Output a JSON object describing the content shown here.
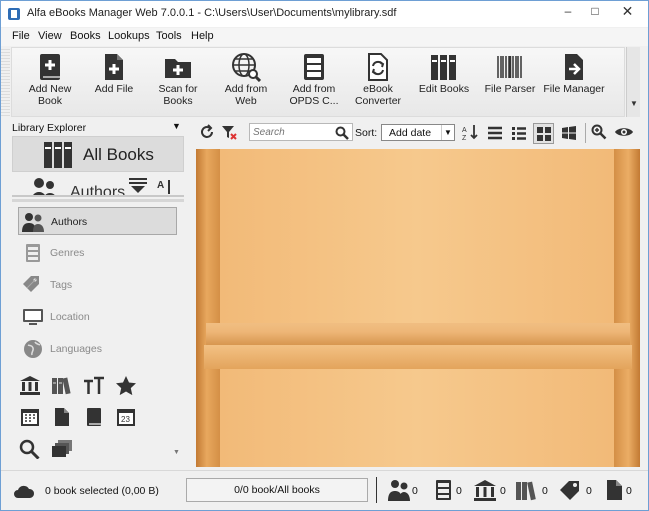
{
  "window": {
    "title": "Alfa eBooks Manager Web 7.0.0.1 - C:\\Users\\User\\Documents\\mylibrary.sdf",
    "minimize": "–",
    "maximize": "□",
    "close": "✕"
  },
  "menu": [
    "File",
    "View",
    "Books",
    "Lookups",
    "Tools",
    "Help"
  ],
  "toolbar": {
    "buttons": [
      {
        "label": "Add New Book",
        "icon": "add-new-book-icon"
      },
      {
        "label": "Add File",
        "icon": "add-file-icon"
      },
      {
        "label": "Scan for Books",
        "icon": "scan-folder-icon"
      },
      {
        "label": "Add from Web",
        "icon": "globe-search-icon"
      },
      {
        "label": "Add from OPDS C...",
        "icon": "opds-cabinet-icon"
      },
      {
        "label": "eBook Converter",
        "icon": "converter-icon"
      },
      {
        "label": "Edit Books",
        "icon": "books-edit-icon"
      },
      {
        "label": "File Parser",
        "icon": "barcode-icon"
      },
      {
        "label": "File Manager",
        "icon": "file-manager-icon"
      }
    ]
  },
  "library_explorer": {
    "header": "Library Explorer",
    "all_books": "All Books",
    "authors_header": "Authors",
    "items": [
      {
        "label": "Authors",
        "icon": "authors-icon",
        "active": true
      },
      {
        "label": "Genres",
        "icon": "genres-icon",
        "active": false
      },
      {
        "label": "Tags",
        "icon": "tags-icon",
        "active": false
      },
      {
        "label": "Location",
        "icon": "monitor-icon",
        "active": false
      },
      {
        "label": "Languages",
        "icon": "globe-icon",
        "active": false
      }
    ],
    "icon_grid": [
      "publisher-icon",
      "series-icon",
      "text-size-icon",
      "star-icon",
      "calendar-icon",
      "document-icon",
      "book-icon",
      "date-23-icon",
      "search-icon",
      "stack-icon"
    ]
  },
  "content_toolbar": {
    "search_placeholder": "Search",
    "sort_label": "Sort:",
    "sort_value": "Add date"
  },
  "status": {
    "selected": "0 book selected (0,00 B)",
    "count": "0/0 book/All books",
    "stats": [
      {
        "icon": "authors-icon",
        "value": "0"
      },
      {
        "icon": "cabinet-icon",
        "value": "0"
      },
      {
        "icon": "publisher-icon",
        "value": "0"
      },
      {
        "icon": "series-icon",
        "value": "0"
      },
      {
        "icon": "tags-icon",
        "value": "0"
      },
      {
        "icon": "file-icon",
        "value": "0"
      }
    ]
  }
}
